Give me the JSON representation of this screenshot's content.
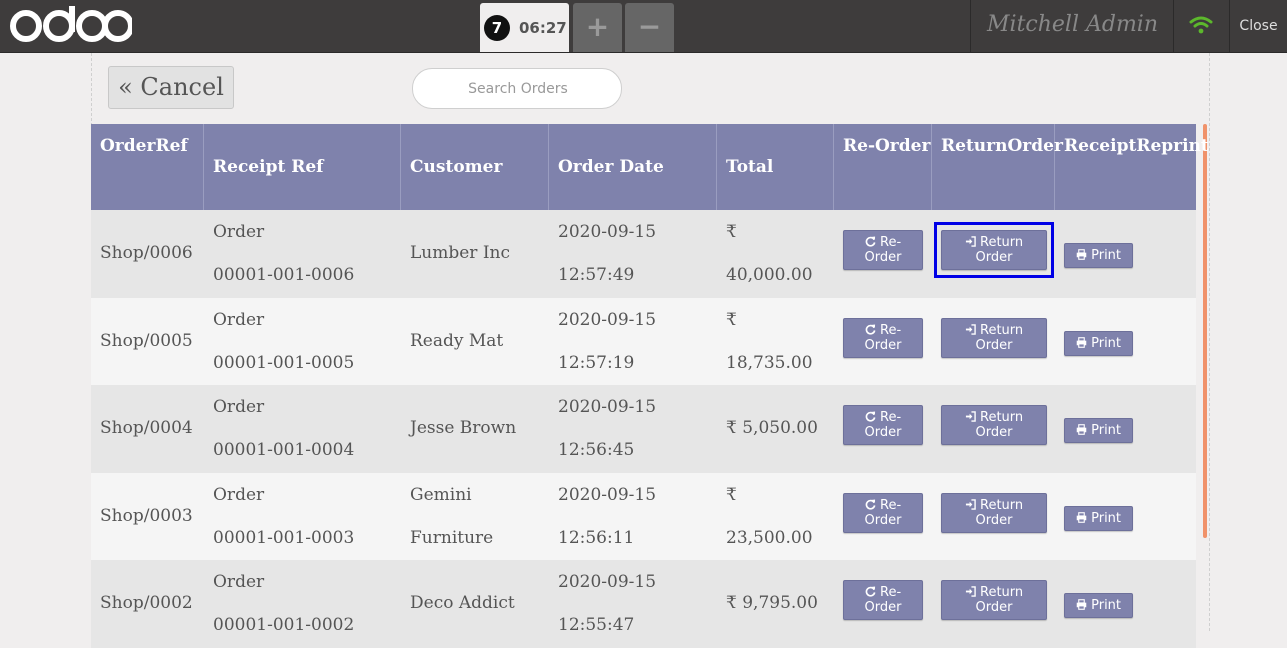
{
  "topbar": {
    "logo": "odoo",
    "order_tab": {
      "number": "7",
      "time": "06:27"
    },
    "add_order_label": "+",
    "remove_order_label": "−",
    "user_name": "Mitchell Admin",
    "wifi_icon": "wifi-icon",
    "close_label": "Close"
  },
  "controls": {
    "cancel_label": "« Cancel",
    "search_placeholder": "Search Orders"
  },
  "table": {
    "headers": {
      "order_ref": [
        "Order",
        "Ref"
      ],
      "receipt_ref": "Receipt Ref",
      "customer": "Customer",
      "order_date": "Order Date",
      "total": "Total",
      "reorder": [
        "Re-",
        "Order"
      ],
      "return_order": [
        "Return",
        "Order"
      ],
      "receipt_reprint": [
        "Receipt",
        "Reprint"
      ]
    },
    "action_labels": {
      "reorder": [
        "Re-",
        "Order"
      ],
      "return_order": [
        "Return",
        "Order"
      ],
      "print": "Print"
    },
    "rows": [
      {
        "order_ref": "Shop/0006",
        "receipt": [
          "Order",
          "00001-001-0006"
        ],
        "customer": [
          "Lumber Inc"
        ],
        "date": [
          "2020-09-15",
          "12:57:49"
        ],
        "total": [
          "₹",
          "40,000.00"
        ]
      },
      {
        "order_ref": "Shop/0005",
        "receipt": [
          "Order",
          "00001-001-0005"
        ],
        "customer": [
          "Ready Mat"
        ],
        "date": [
          "2020-09-15",
          "12:57:19"
        ],
        "total": [
          "₹",
          "18,735.00"
        ]
      },
      {
        "order_ref": "Shop/0004",
        "receipt": [
          "Order",
          "00001-001-0004"
        ],
        "customer": [
          "Jesse Brown"
        ],
        "date": [
          "2020-09-15",
          "12:56:45"
        ],
        "total": [
          "₹ 5,050.00"
        ]
      },
      {
        "order_ref": "Shop/0003",
        "receipt": [
          "Order",
          "00001-001-0003"
        ],
        "customer": [
          "Gemini",
          "Furniture"
        ],
        "date": [
          "2020-09-15",
          "12:56:11"
        ],
        "total": [
          "₹",
          "23,500.00"
        ]
      },
      {
        "order_ref": "Shop/0002",
        "receipt": [
          "Order",
          "00001-001-0002"
        ],
        "customer": [
          "Deco Addict"
        ],
        "date": [
          "2020-09-15",
          "12:55:47"
        ],
        "total": [
          "₹ 9,795.00"
        ]
      }
    ],
    "highlighted_row": 0,
    "colors": {
      "header_bg": "#7f82ac",
      "focus": "#0000e6",
      "scroll": "#f0926a"
    }
  }
}
